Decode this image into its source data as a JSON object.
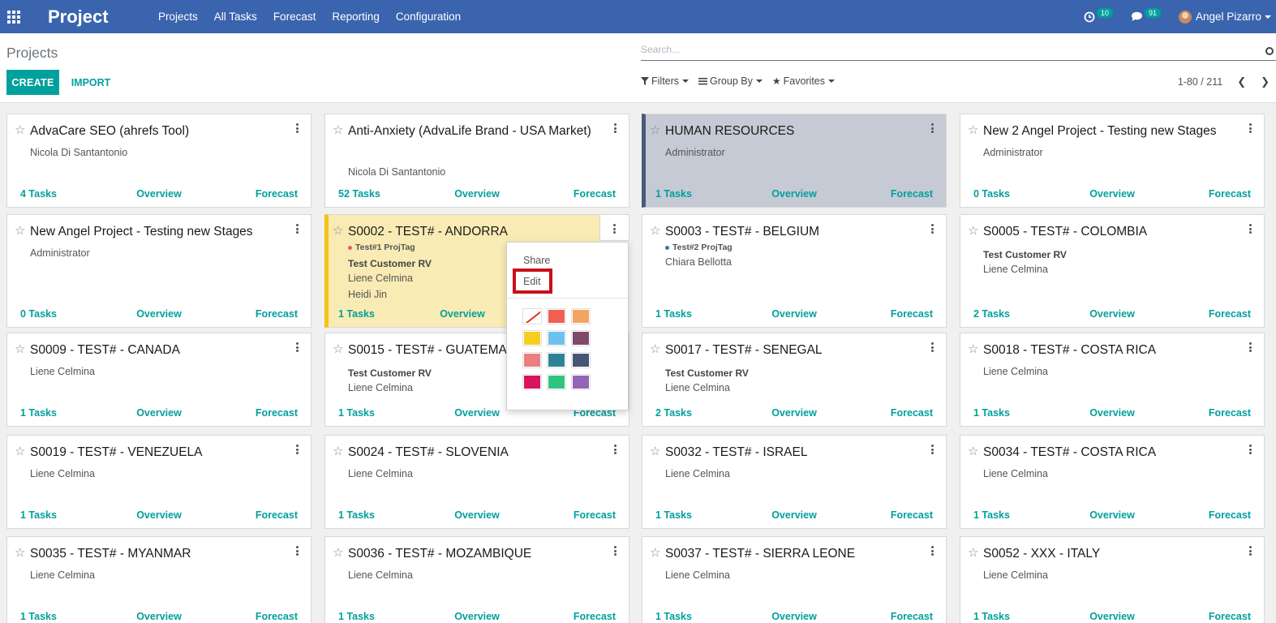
{
  "navbar": {
    "app_title": "Project",
    "menu": [
      "Projects",
      "All Tasks",
      "Forecast",
      "Reporting",
      "Configuration"
    ],
    "activity_count": "10",
    "messages_count": "91",
    "user_name": "Angel Pizarro"
  },
  "control_panel": {
    "breadcrumb": "Projects",
    "create_label": "CREATE",
    "import_label": "IMPORT",
    "search_placeholder": "Search...",
    "filters_label": "Filters",
    "groupby_label": "Group By",
    "favorites_label": "Favorites",
    "pager_value": "1-80 / 211"
  },
  "card_footer": {
    "overview": "Overview",
    "forecast": "Forecast"
  },
  "cards": [
    {
      "title": "AdvaCare SEO (ahrefs Tool)",
      "lines": [
        "Nicola Di Santantonio"
      ],
      "tasks_count": "4",
      "tasks_label": " Tasks"
    },
    {
      "title": "Anti-Anxiety (AdvaLife Brand - USA Market)",
      "lines": [
        "Nicola Di Santantonio"
      ],
      "tasks_count": "52",
      "tasks_label": " Tasks"
    },
    {
      "title": "HUMAN RESOURCES",
      "lines": [
        "Administrator"
      ],
      "tasks_count": "1",
      "tasks_label": " Tasks"
    },
    {
      "title": "New 2 Angel Project - Testing new Stages",
      "lines": [
        "Administrator"
      ],
      "tasks_count": "0",
      "tasks_label": " Tasks"
    },
    {
      "title": "New Angel Project - Testing new Stages",
      "lines": [
        "Administrator"
      ],
      "tasks_count": "0",
      "tasks_label": " Tasks"
    },
    {
      "title": "S0002 - TEST# - ANDORRA",
      "tag": "Test#1 ProjTag",
      "customer": "Test Customer RV",
      "lines": [
        "Liene Celmina",
        "Heidi Jin"
      ],
      "tasks_count": "1",
      "tasks_label": " Tasks"
    },
    {
      "title": "S0003 - TEST# - BELGIUM",
      "tag": "Test#2 ProjTag",
      "lines": [
        "Chiara Bellotta"
      ],
      "tasks_count": "1",
      "tasks_label": " Tasks"
    },
    {
      "title": "S0005 - TEST# - COLOMBIA",
      "customer": "Test Customer RV",
      "lines": [
        "Liene Celmina"
      ],
      "tasks_count": "2",
      "tasks_label": " Tasks"
    },
    {
      "title": "S0009 - TEST# - CANADA",
      "lines": [
        "Liene Celmina"
      ],
      "tasks_count": "1",
      "tasks_label": " Tasks"
    },
    {
      "title": "S0015 - TEST# - GUATEMA",
      "customer": "Test Customer RV",
      "lines": [
        "Liene Celmina"
      ],
      "tasks_count": "1",
      "tasks_label": " Tasks"
    },
    {
      "title": "S0017 - TEST# - SENEGAL",
      "customer": "Test Customer RV",
      "lines": [
        "Liene Celmina"
      ],
      "tasks_count": "2",
      "tasks_label": " Tasks"
    },
    {
      "title": "S0018 - TEST# - COSTA RICA",
      "lines": [
        "Liene Celmina"
      ],
      "tasks_count": "1",
      "tasks_label": " Tasks"
    },
    {
      "title": "S0019 - TEST# - VENEZUELA",
      "lines": [
        "Liene Celmina"
      ],
      "tasks_count": "1",
      "tasks_label": " Tasks"
    },
    {
      "title": "S0024 - TEST# - SLOVENIA",
      "lines": [
        "Liene Celmina"
      ],
      "tasks_count": "1",
      "tasks_label": " Tasks"
    },
    {
      "title": "S0032 - TEST# - ISRAEL",
      "lines": [
        "Liene Celmina"
      ],
      "tasks_count": "1",
      "tasks_label": " Tasks"
    },
    {
      "title": "S0034 - TEST# - COSTA RICA",
      "lines": [
        "Liene Celmina"
      ],
      "tasks_count": "1",
      "tasks_label": " Tasks"
    },
    {
      "title": "S0035 - TEST# - MYANMAR",
      "lines": [
        "Liene Celmina"
      ],
      "tasks_count": "1",
      "tasks_label": " Tasks"
    },
    {
      "title": "S0036 - TEST# - MOZAMBIQUE",
      "lines": [
        "Liene Celmina"
      ],
      "tasks_count": "1",
      "tasks_label": " Tasks"
    },
    {
      "title": "S0037 - TEST# - SIERRA LEONE",
      "lines": [
        "Liene Celmina"
      ],
      "tasks_count": "1",
      "tasks_label": " Tasks"
    },
    {
      "title": "S0052 - XXX - ITALY",
      "lines": [
        "Liene Celmina"
      ],
      "tasks_count": "1",
      "tasks_label": " Tasks"
    }
  ],
  "dropdown": {
    "share_label": "Share",
    "edit_label": "Edit",
    "colors": [
      "none",
      "#f06050",
      "#f4a460",
      "#f7cd1f",
      "#6cc1ed",
      "#814968",
      "#eb7e7f",
      "#2c8397",
      "#475577",
      "#d6145f",
      "#30c381",
      "#9365b8"
    ]
  },
  "colors": {
    "brand": "#3b64ae",
    "accent": "#00a09d",
    "highlight": "#c8101a"
  }
}
